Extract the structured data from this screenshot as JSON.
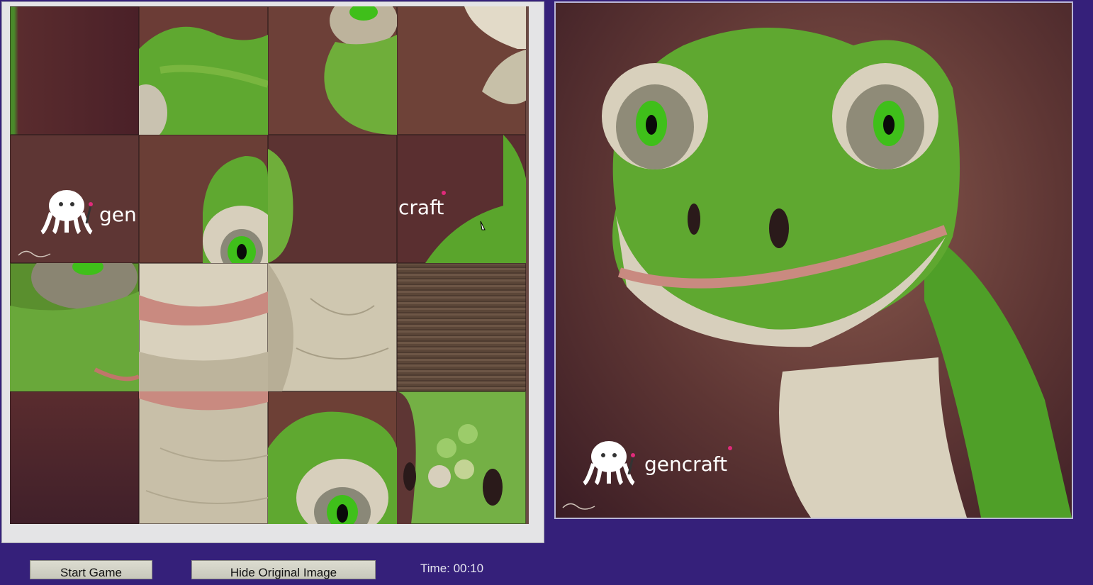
{
  "controls": {
    "start_label": "Start Game",
    "hide_label": "Hide Original Image",
    "timer_text": "Time: 00:10"
  },
  "watermark": {
    "brand": "gencraft",
    "tile_left_text": "gen",
    "tile_right_text": "craft"
  },
  "puzzle": {
    "grid": "4x4",
    "empty_tile_style": "wood"
  },
  "colors": {
    "page_background": "#35207a",
    "lizard_green": "#5fa830",
    "background_brown": "#5e3634"
  }
}
